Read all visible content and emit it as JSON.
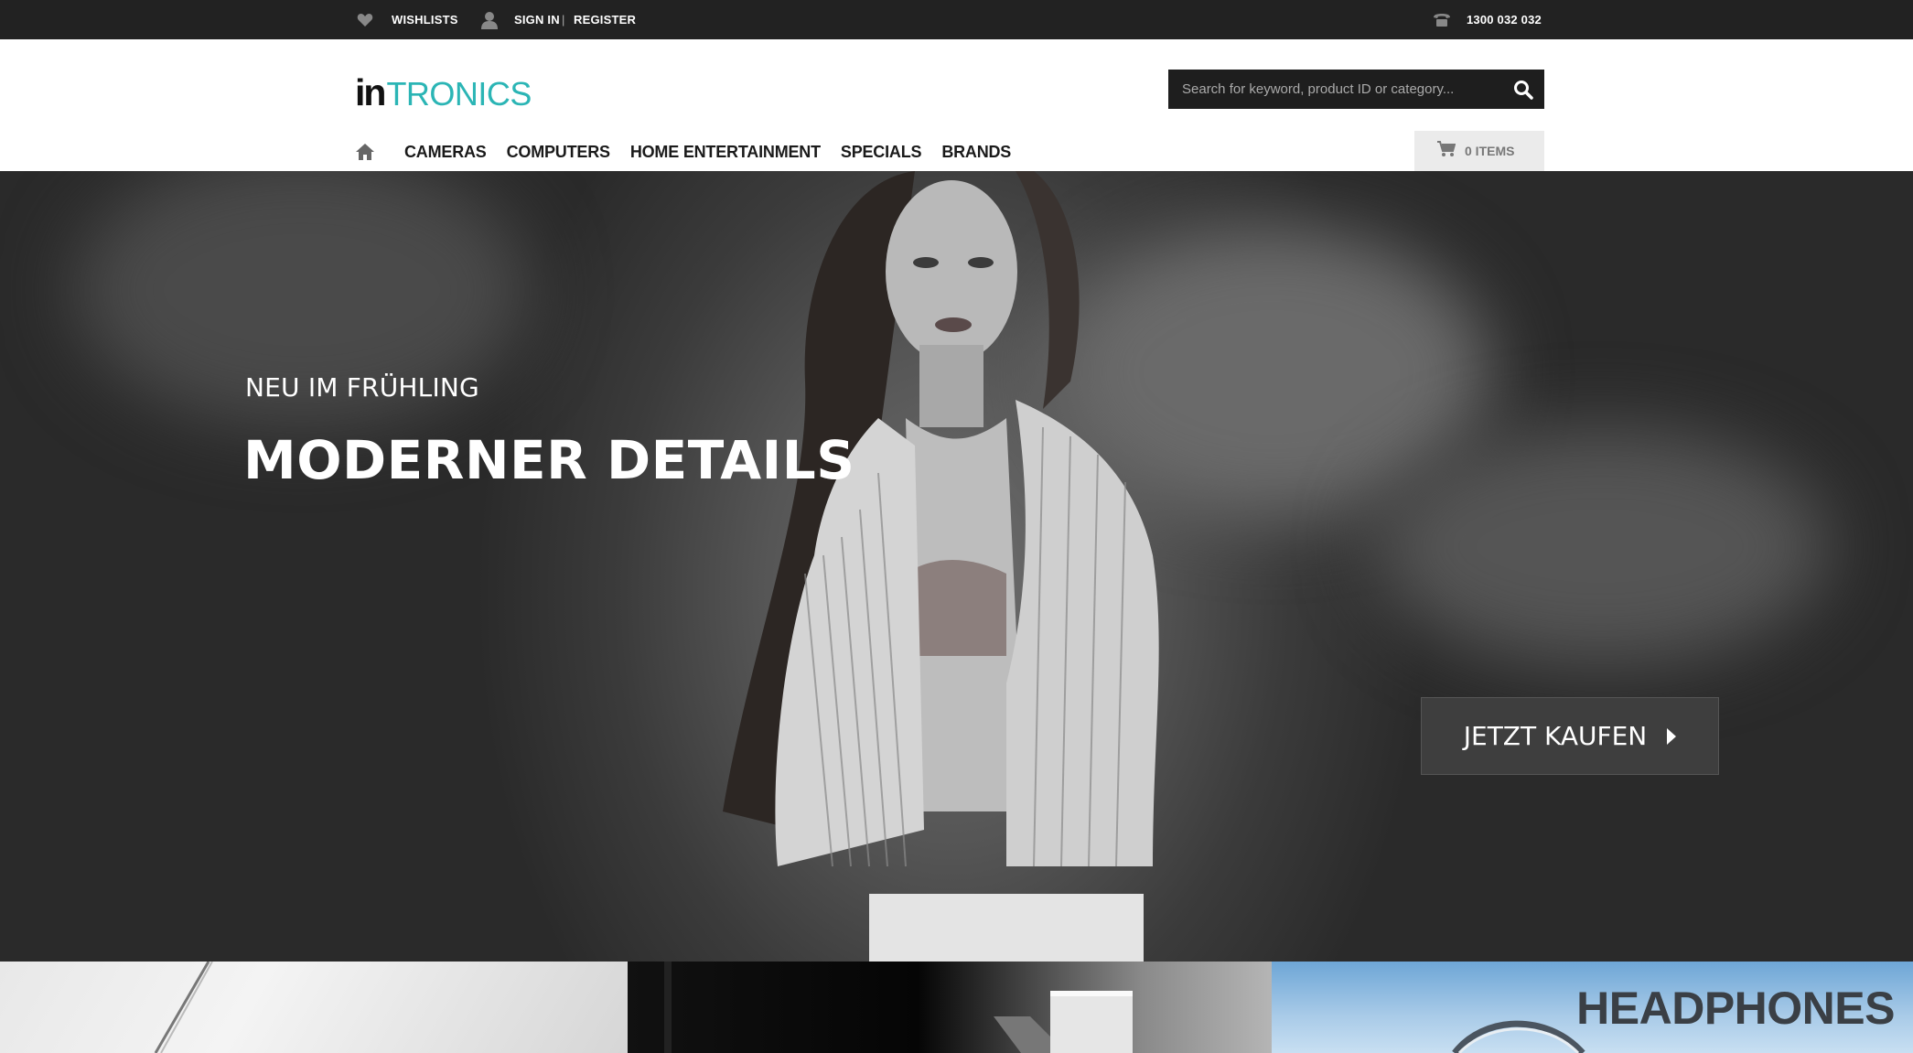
{
  "topbar": {
    "wishlists": "WISHLISTS",
    "sign_in": "SIGN IN",
    "separator": "|",
    "register": "REGISTER",
    "phone": "1300 032 032",
    "icons": [
      "heart-icon",
      "user-icon",
      "phone-icon"
    ]
  },
  "header": {
    "logo_in": "in",
    "logo_tronics": "TRONICS",
    "logo_colors": {
      "in": "#111111",
      "tronics": "#2bb5b5"
    },
    "search_placeholder": "Search for keyword, product ID or category..."
  },
  "nav": {
    "items": [
      "CAMERAS",
      "COMPUTERS",
      "HOME ENTERTAINMENT",
      "SPECIALS",
      "BRANDS"
    ],
    "cart_label": "0 ITEMS"
  },
  "hero": {
    "eyebrow": "NEU IM FRÜHLING",
    "headline": "MODERNER DETAILS",
    "cta_label": "JETZT KAUFEN"
  },
  "tiles": {
    "headphones_title": "HEADPHONES"
  },
  "colors": {
    "topbar_bg": "#222222",
    "accent": "#2bb5b5",
    "search_bg": "#1e1e1e",
    "cart_bg": "#ebebeb"
  }
}
